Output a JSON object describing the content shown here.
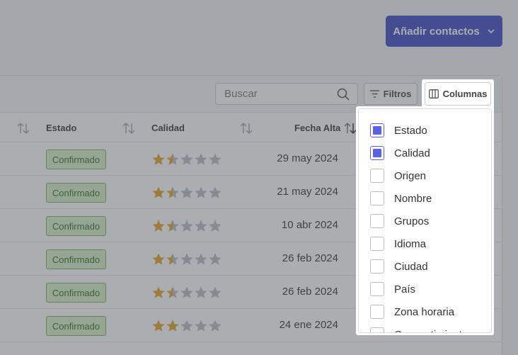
{
  "header": {
    "add_contacts_label": "Añadir contactos"
  },
  "toolbar": {
    "search_placeholder": "Buscar",
    "filters_label": "Filtros",
    "columns_label": "Columnas"
  },
  "table": {
    "columns": [
      "Estado",
      "Calidad",
      "Fecha Alta"
    ],
    "rows": [
      {
        "status": "Confirmado",
        "quality": 1.5,
        "date": "29 may 2024"
      },
      {
        "status": "Confirmado",
        "quality": 1.5,
        "date": "21 may 2024"
      },
      {
        "status": "Confirmado",
        "quality": 1.5,
        "date": "10 abr 2024"
      },
      {
        "status": "Confirmado",
        "quality": 1.5,
        "date": "26 feb 2024"
      },
      {
        "status": "Confirmado",
        "quality": 1.5,
        "date": "26 feb 2024"
      },
      {
        "status": "Confirmado",
        "quality": 2,
        "date": "24 ene 2024"
      }
    ]
  },
  "columns_menu": {
    "options": [
      {
        "label": "Estado",
        "checked": true
      },
      {
        "label": "Calidad",
        "checked": true
      },
      {
        "label": "Origen",
        "checked": false
      },
      {
        "label": "Nombre",
        "checked": false
      },
      {
        "label": "Grupos",
        "checked": false
      },
      {
        "label": "Idioma",
        "checked": false
      },
      {
        "label": "Ciudad",
        "checked": false
      },
      {
        "label": "País",
        "checked": false
      },
      {
        "label": "Zona horaria",
        "checked": false
      },
      {
        "label": "Consentimiento",
        "checked": false
      }
    ]
  },
  "colors": {
    "accent": "#3a45c4",
    "checkbox": "#5a63e8",
    "badge_bg": "#d8f0c8",
    "star_filled": "#e0a524",
    "star_empty": "#b9bcc4"
  }
}
